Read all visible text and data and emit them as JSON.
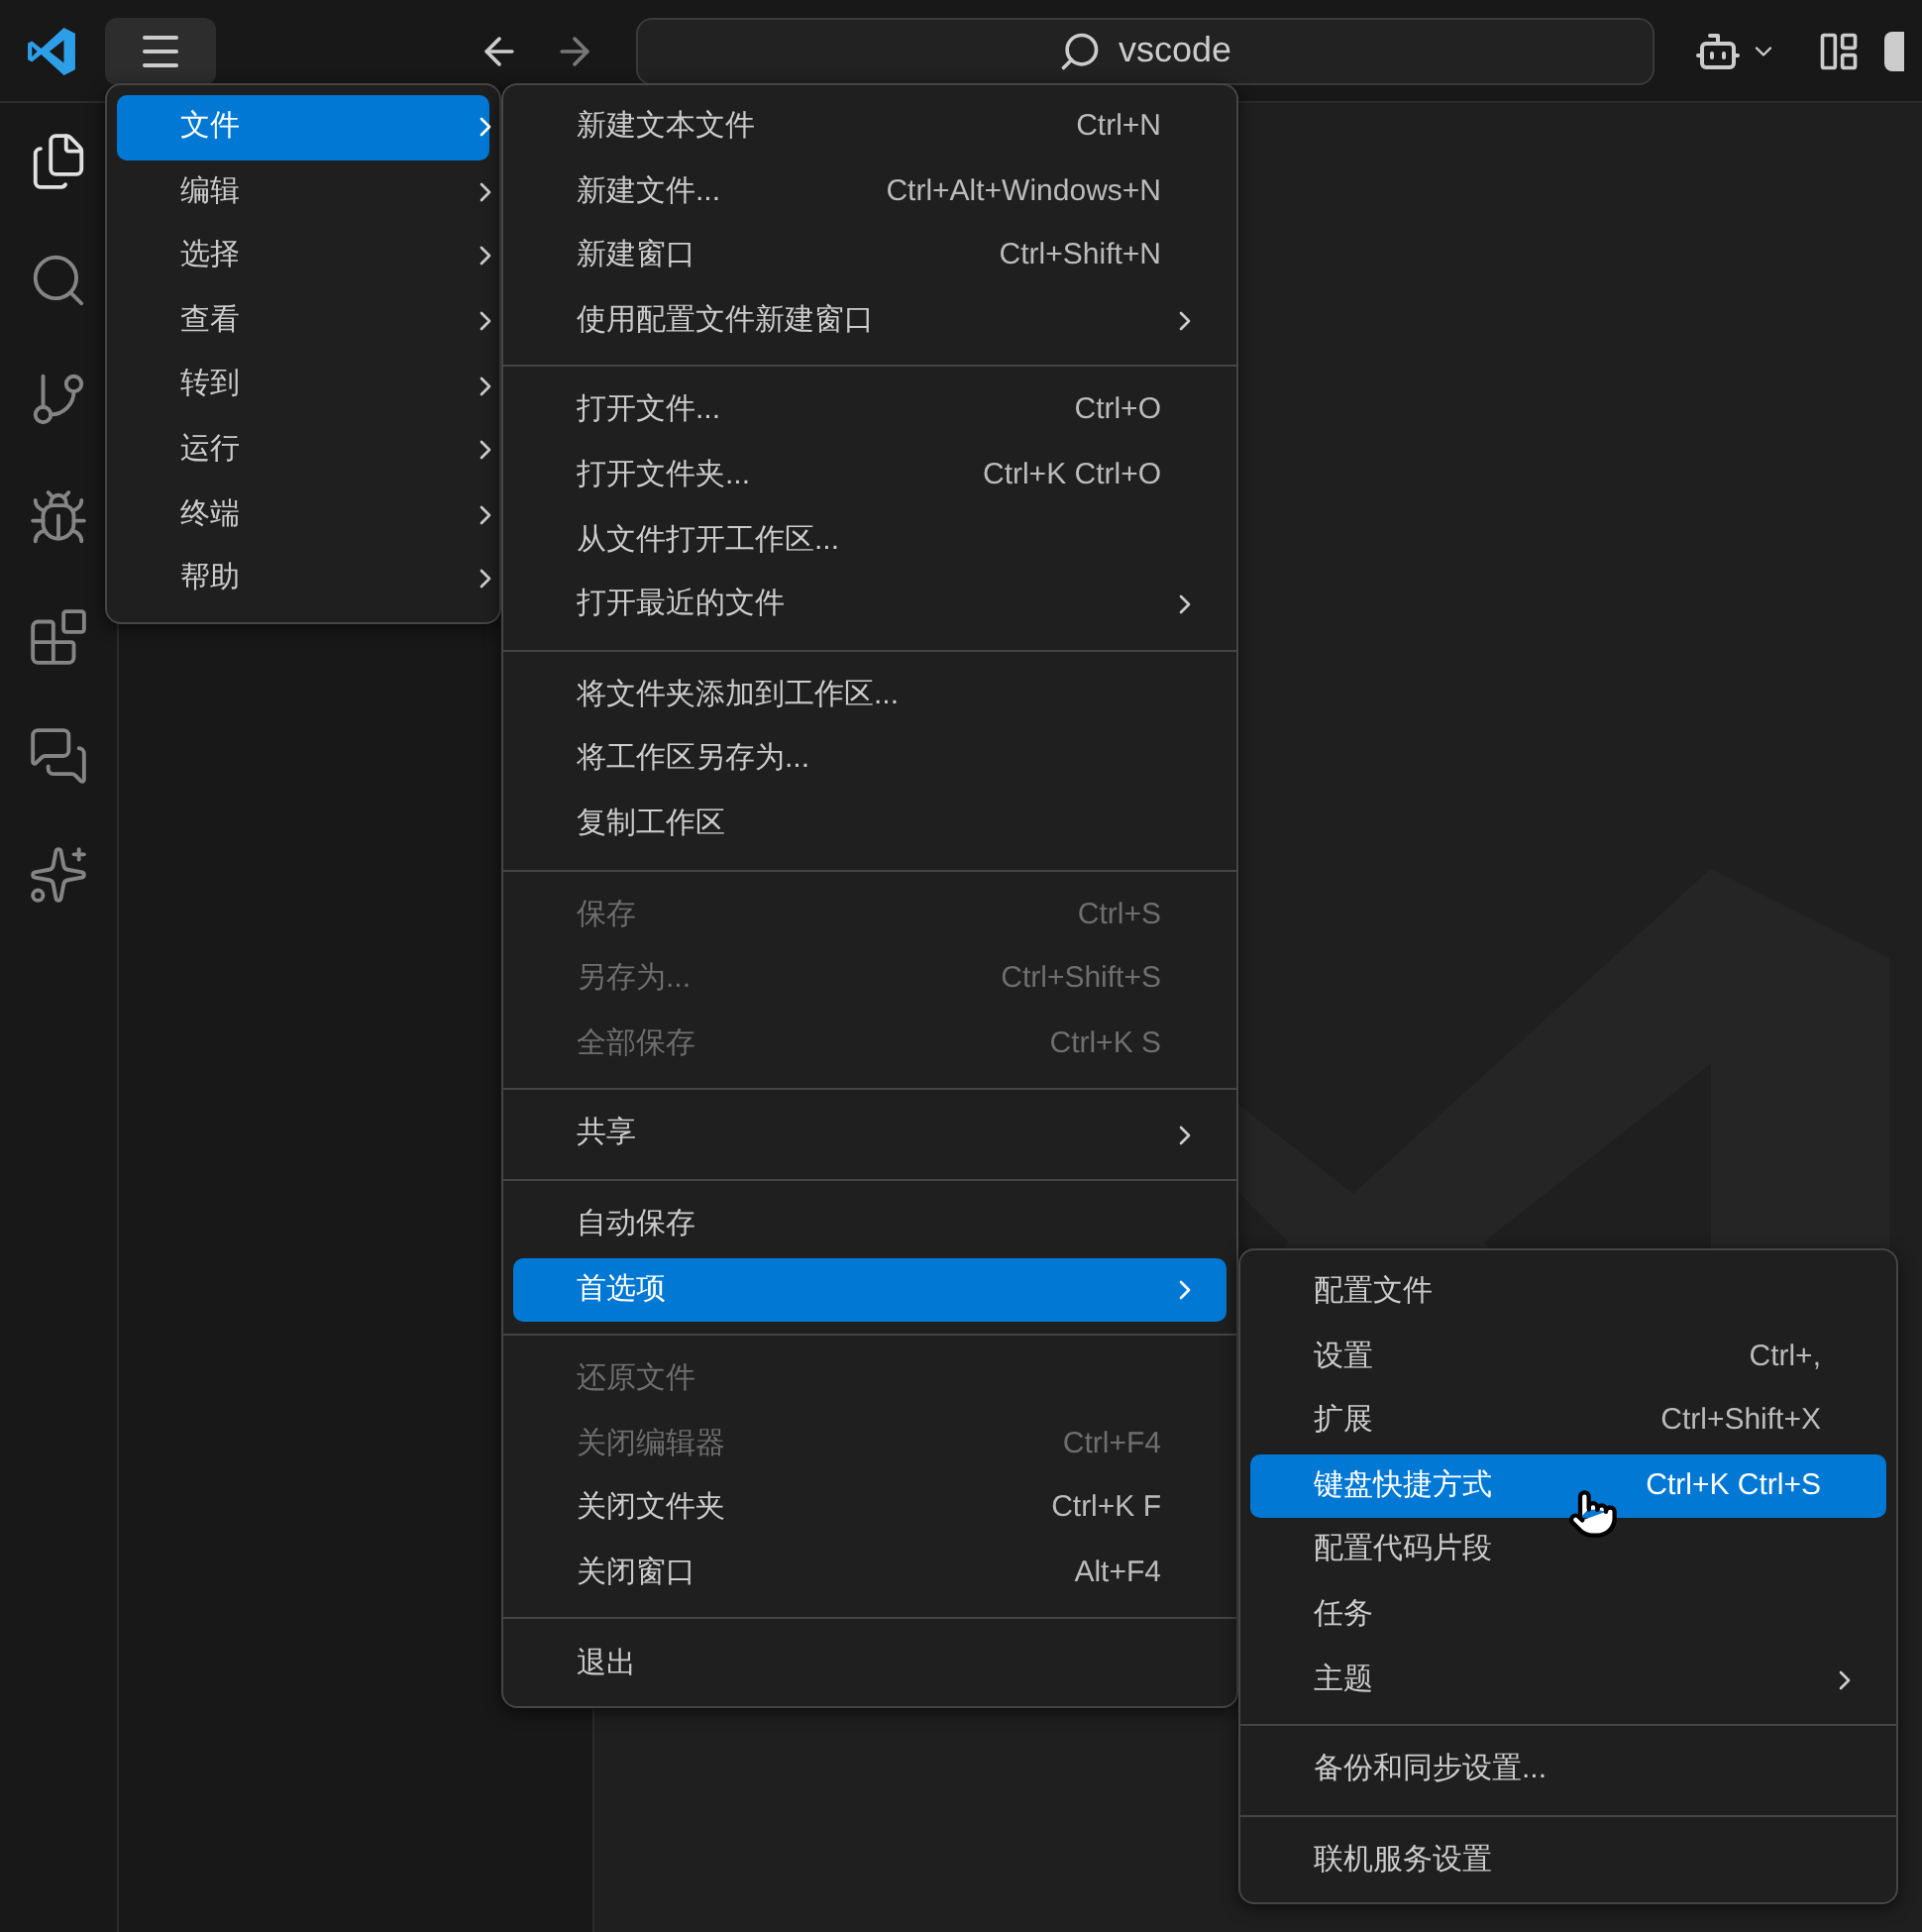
{
  "title_bar": {
    "menu_button": {
      "selected": true
    },
    "search": {
      "value": "vscode"
    }
  },
  "activity_bar": {
    "items": [
      {
        "kind": "files",
        "selected": true
      },
      {
        "kind": "search",
        "selected": false
      },
      {
        "kind": "source-control",
        "selected": false
      },
      {
        "kind": "run-debug",
        "selected": false
      },
      {
        "kind": "extensions",
        "selected": false
      },
      {
        "kind": "chat",
        "selected": false
      },
      {
        "kind": "star",
        "selected": false
      }
    ]
  },
  "menus": [
    {
      "kind": "main",
      "groups": [
        [
          {
            "label": "文件",
            "submenu": true,
            "disabled": false,
            "selected": true
          },
          {
            "label": "编辑",
            "submenu": true,
            "disabled": false,
            "selected": false
          },
          {
            "label": "选择",
            "submenu": true,
            "disabled": false,
            "selected": false
          },
          {
            "label": "查看",
            "submenu": true,
            "disabled": false,
            "selected": false
          },
          {
            "label": "转到",
            "submenu": true,
            "disabled": false,
            "selected": false
          },
          {
            "label": "运行",
            "submenu": true,
            "disabled": false,
            "selected": false
          },
          {
            "label": "终端",
            "submenu": true,
            "disabled": false,
            "selected": false
          },
          {
            "label": "帮助",
            "submenu": true,
            "disabled": false,
            "selected": false
          }
        ]
      ]
    },
    {
      "kind": "file",
      "groups": [
        [
          {
            "label": "新建文本文件",
            "shortcut": "Ctrl+N",
            "submenu": false,
            "disabled": false,
            "selected": false
          },
          {
            "label": "新建文件...",
            "shortcut": "Ctrl+Alt+Windows+N",
            "submenu": false,
            "disabled": false,
            "selected": false
          },
          {
            "label": "新建窗口",
            "shortcut": "Ctrl+Shift+N",
            "submenu": false,
            "disabled": false,
            "selected": false
          },
          {
            "label": "使用配置文件新建窗口",
            "submenu": true,
            "disabled": false,
            "selected": false
          }
        ],
        [
          {
            "label": "打开文件...",
            "shortcut": "Ctrl+O",
            "submenu": false,
            "disabled": false,
            "selected": false
          },
          {
            "label": "打开文件夹...",
            "shortcut": "Ctrl+K Ctrl+O",
            "submenu": false,
            "disabled": false,
            "selected": false
          },
          {
            "label": "从文件打开工作区...",
            "submenu": false,
            "disabled": false,
            "selected": false
          },
          {
            "label": "打开最近的文件",
            "submenu": true,
            "disabled": false,
            "selected": false
          }
        ],
        [
          {
            "label": "将文件夹添加到工作区...",
            "submenu": false,
            "disabled": false,
            "selected": false
          },
          {
            "label": "将工作区另存为...",
            "submenu": false,
            "disabled": false,
            "selected": false
          },
          {
            "label": "复制工作区",
            "submenu": false,
            "disabled": false,
            "selected": false
          }
        ],
        [
          {
            "label": "保存",
            "shortcut": "Ctrl+S",
            "submenu": false,
            "disabled": true,
            "selected": false
          },
          {
            "label": "另存为...",
            "shortcut": "Ctrl+Shift+S",
            "submenu": false,
            "disabled": true,
            "selected": false
          },
          {
            "label": "全部保存",
            "shortcut": "Ctrl+K S",
            "submenu": false,
            "disabled": true,
            "selected": false
          }
        ],
        [
          {
            "label": "共享",
            "submenu": true,
            "disabled": false,
            "selected": false
          }
        ],
        [
          {
            "label": "自动保存",
            "submenu": false,
            "disabled": false,
            "selected": false
          },
          {
            "label": "首选项",
            "submenu": true,
            "disabled": false,
            "selected": true
          }
        ],
        [
          {
            "label": "还原文件",
            "submenu": false,
            "disabled": true,
            "selected": false
          },
          {
            "label": "关闭编辑器",
            "shortcut": "Ctrl+F4",
            "submenu": false,
            "disabled": true,
            "selected": false
          },
          {
            "label": "关闭文件夹",
            "shortcut": "Ctrl+K F",
            "submenu": false,
            "disabled": false,
            "selected": false
          },
          {
            "label": "关闭窗口",
            "shortcut": "Alt+F4",
            "submenu": false,
            "disabled": false,
            "selected": false
          }
        ],
        [
          {
            "label": "退出",
            "submenu": false,
            "disabled": false,
            "selected": false
          }
        ]
      ]
    },
    {
      "kind": "preferences",
      "groups": [
        [
          {
            "label": "配置文件",
            "submenu": false,
            "disabled": false,
            "selected": false
          },
          {
            "label": "设置",
            "shortcut": "Ctrl+,",
            "submenu": false,
            "disabled": false,
            "selected": false
          },
          {
            "label": "扩展",
            "shortcut": "Ctrl+Shift+X",
            "submenu": false,
            "disabled": false,
            "selected": false
          },
          {
            "label": "键盘快捷方式",
            "shortcut": "Ctrl+K Ctrl+S",
            "submenu": false,
            "disabled": false,
            "selected": true
          },
          {
            "label": "配置代码片段",
            "submenu": false,
            "disabled": false,
            "selected": false
          },
          {
            "label": "任务",
            "submenu": false,
            "disabled": false,
            "selected": false
          },
          {
            "label": "主题",
            "submenu": true,
            "disabled": false,
            "selected": false
          }
        ],
        [
          {
            "label": "备份和同步设置...",
            "submenu": false,
            "disabled": false,
            "selected": false
          }
        ],
        [
          {
            "label": "联机服务设置",
            "submenu": false,
            "disabled": false,
            "selected": false
          }
        ]
      ]
    }
  ]
}
